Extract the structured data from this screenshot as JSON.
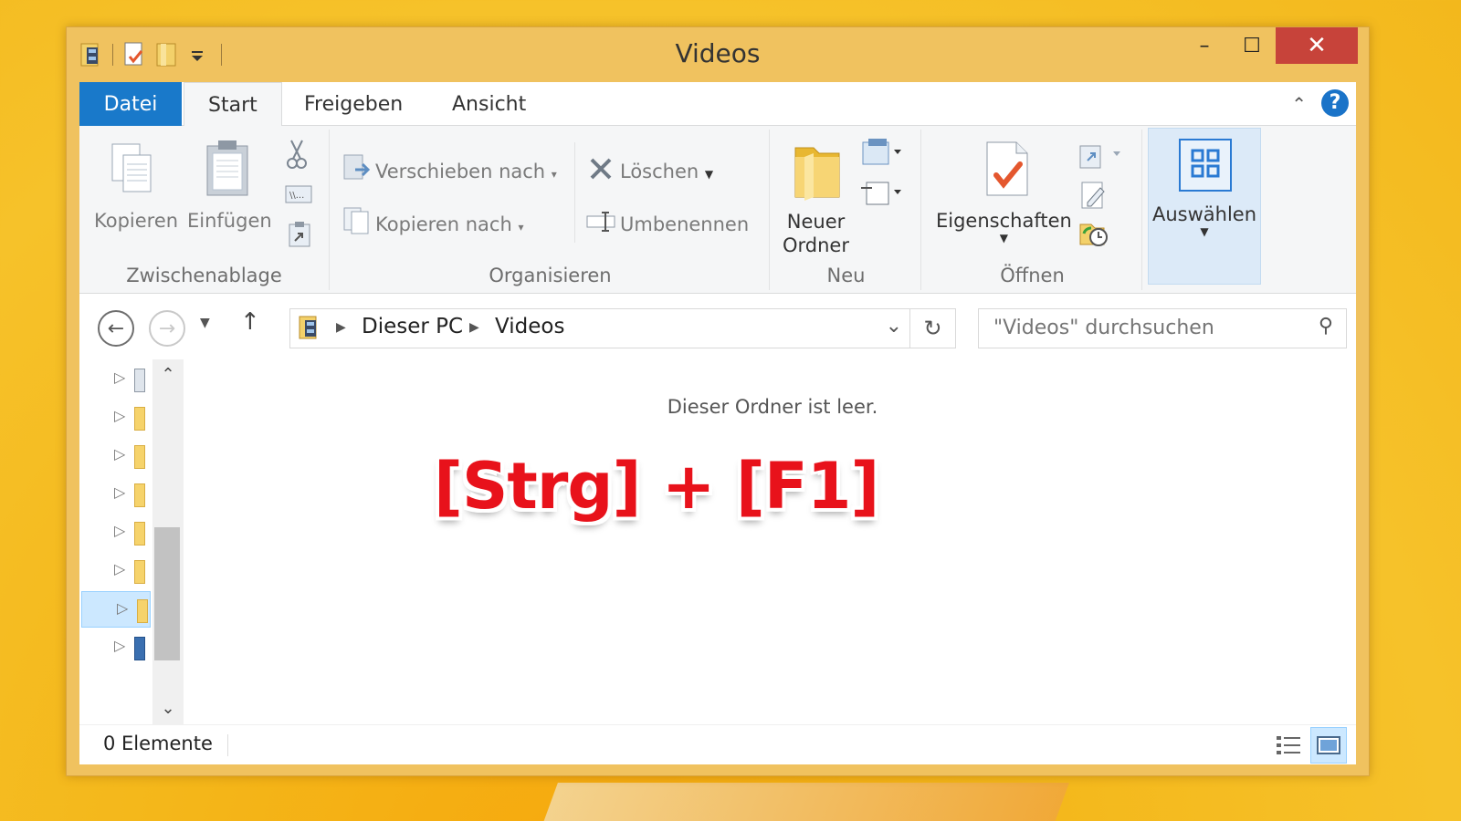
{
  "window": {
    "title": "Videos",
    "controls": {
      "minimize": "–",
      "maximize": "☐",
      "close": "✕"
    }
  },
  "tabs": {
    "file": "Datei",
    "start": "Start",
    "share": "Freigeben",
    "view": "Ansicht"
  },
  "ribbon": {
    "clipboard": {
      "copy": "Kopieren",
      "paste": "Einfügen",
      "label": "Zwischenablage"
    },
    "organize": {
      "move_to": "Verschieben nach",
      "copy_to": "Kopieren nach",
      "delete": "Löschen",
      "rename": "Umbenennen",
      "label": "Organisieren"
    },
    "new": {
      "new_folder_line1": "Neuer",
      "new_folder_line2": "Ordner",
      "label": "Neu"
    },
    "open": {
      "properties": "Eigenschaften",
      "label": "Öffnen"
    },
    "select": {
      "select": "Auswählen"
    }
  },
  "nav": {
    "breadcrumb": [
      "Dieser PC",
      "Videos"
    ],
    "search_placeholder": "\"Videos\" durchsuchen"
  },
  "content": {
    "empty_message": "Dieser Ordner ist leer.",
    "overlay": "[Strg] + [F1]"
  },
  "status": {
    "count": "0 Elemente"
  },
  "colors": {
    "accent": "#1979ca",
    "close": "#c7433a",
    "frame": "#f0c25f",
    "overlay": "#e8121b"
  }
}
